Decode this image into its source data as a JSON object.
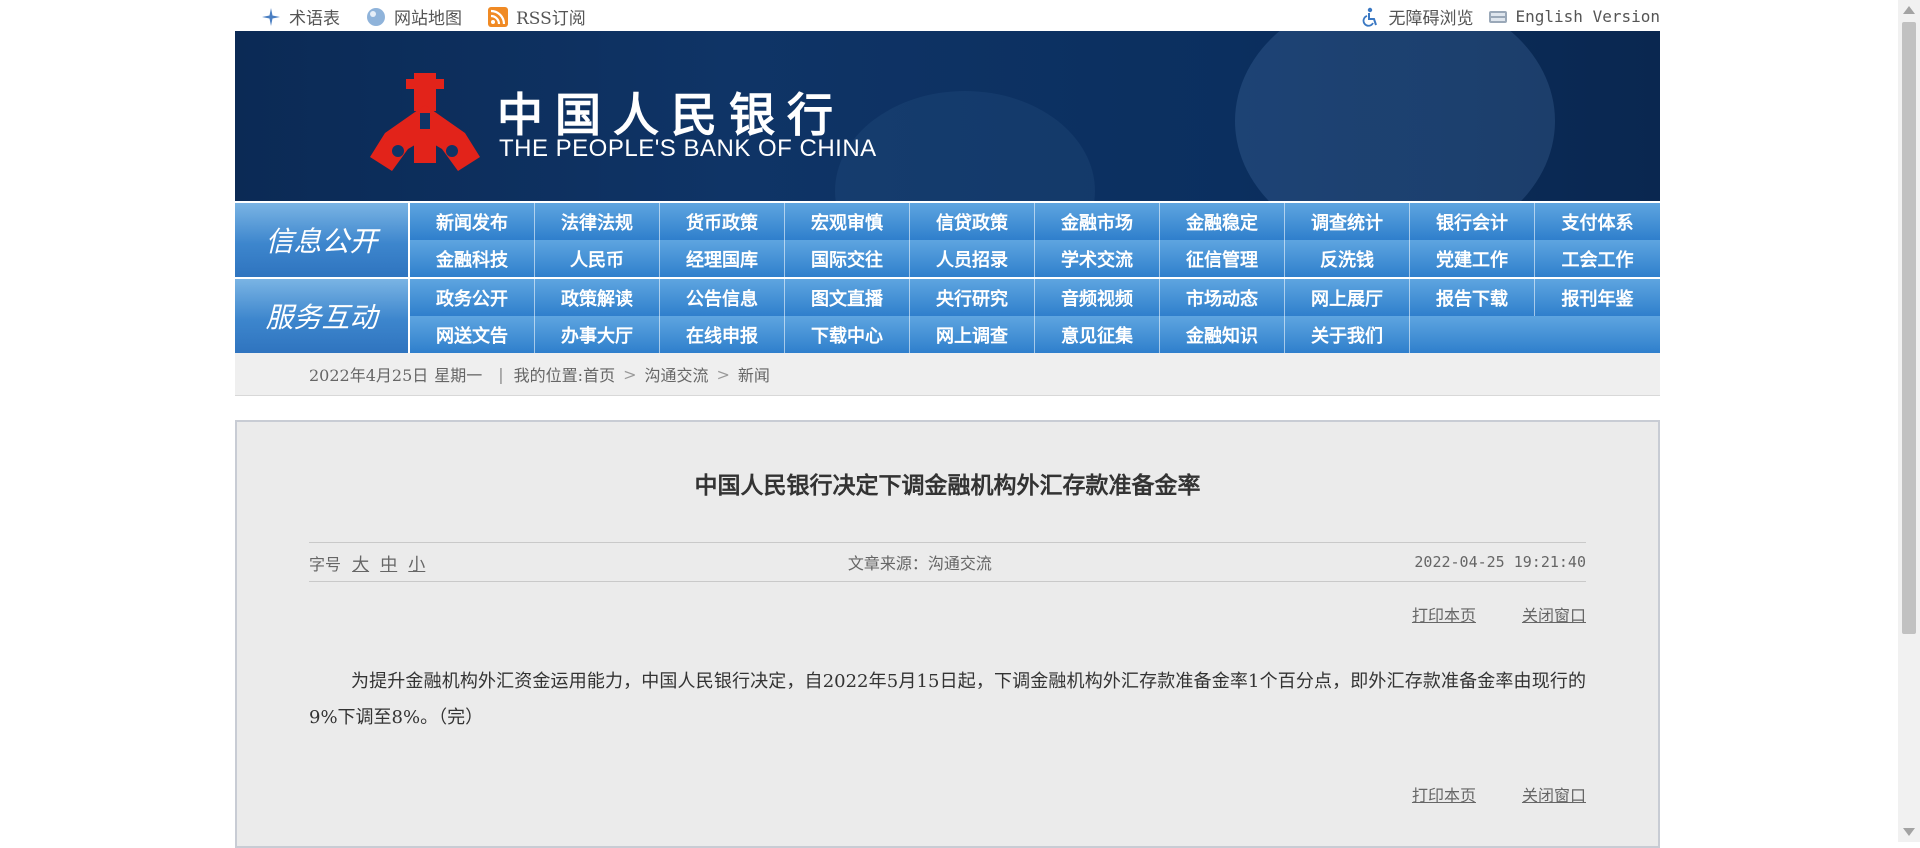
{
  "utility": {
    "left": [
      {
        "label": "术语表",
        "icon": "crosshair-icon"
      },
      {
        "label": "网站地图",
        "icon": "globe-icon"
      },
      {
        "label": "RSS订阅",
        "icon": "rss-icon"
      }
    ],
    "right": [
      {
        "label": "无障碍浏览",
        "icon": "accessibility-icon"
      },
      {
        "label": "English Version",
        "icon": "keyboard-icon"
      }
    ]
  },
  "banner": {
    "cn_name": "中国人民银行",
    "en_name": "THE PEOPLE'S BANK OF CHINA"
  },
  "nav": {
    "info": {
      "label": "信息公开",
      "items": [
        "新闻发布",
        "法律法规",
        "货币政策",
        "宏观审慎",
        "信贷政策",
        "金融市场",
        "金融稳定",
        "调查统计",
        "银行会计",
        "支付体系",
        "金融科技",
        "人民币",
        "经理国库",
        "国际交往",
        "人员招录",
        "学术交流",
        "征信管理",
        "反洗钱",
        "党建工作",
        "工会工作"
      ]
    },
    "service": {
      "label": "服务互动",
      "items": [
        "政务公开",
        "政策解读",
        "公告信息",
        "图文直播",
        "央行研究",
        "音频视频",
        "市场动态",
        "网上展厅",
        "报告下载",
        "报刊年鉴",
        "网送文告",
        "办事大厅",
        "在线申报",
        "下载中心",
        "网上调查",
        "意见征集",
        "金融知识",
        "关于我们"
      ]
    }
  },
  "breadcrumb": {
    "date": "2022年4月25日",
    "weekday": "星期一",
    "separator": "|",
    "prefix": "我的位置:",
    "path": [
      "首页",
      "沟通交流",
      "新闻"
    ],
    "arrow": ">"
  },
  "article": {
    "title": "中国人民银行决定下调金融机构外汇存款准备金率",
    "font_size_label": "字号",
    "font_sizes": [
      "大",
      "中",
      "小"
    ],
    "source_label": "文章来源：",
    "source": "沟通交流",
    "datetime": "2022-04-25 19:21:40",
    "print_label": "打印本页",
    "close_label": "关闭窗口",
    "body": "为提升金融机构外汇资金运用能力，中国人民银行决定，自2022年5月15日起，下调金融机构外汇存款准备金率1个百分点，即外汇存款准备金率由现行的9%下调至8%。（完）"
  },
  "colors": {
    "banner_bg": "#0f3466",
    "nav_blue": "#2f7fcc",
    "logo_red": "#e2231a"
  }
}
